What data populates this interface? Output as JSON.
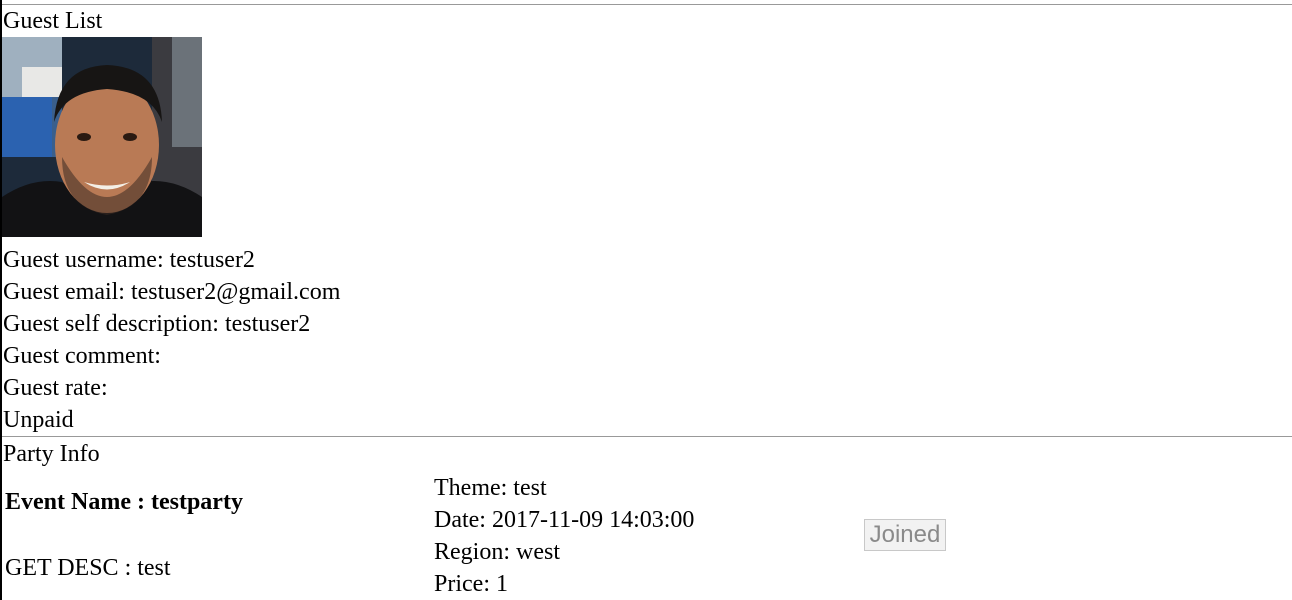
{
  "guest_list": {
    "title": "Guest List",
    "username": "Guest username: testuser2",
    "email": "Guest email: testuser2@gmail.com",
    "self_description": "Guest self description: testuser2",
    "comment": "Guest comment:",
    "rate": "Guest rate:",
    "payment_status": "Unpaid"
  },
  "party_info": {
    "title": "Party Info",
    "event_name": "Event Name : testparty",
    "get_desc": "GET DESC : test",
    "theme": "Theme: test",
    "date": "Date: 2017-11-09 14:03:00",
    "region": "Region: west",
    "price": "Price: 1",
    "joined_label": "Joined"
  },
  "colors": {
    "rule": "#999999",
    "button_bg": "#f2f2f2",
    "button_text": "#8a8a8a"
  }
}
